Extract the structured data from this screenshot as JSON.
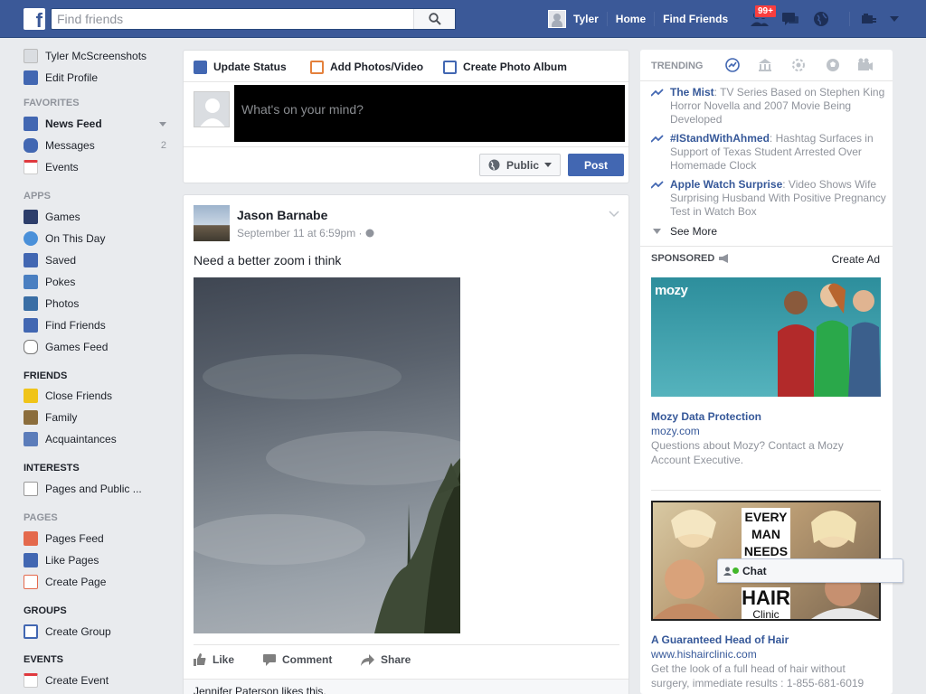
{
  "header": {
    "logo": "f",
    "search_placeholder": "Find friends",
    "profile_name": "Tyler",
    "home": "Home",
    "find_friends": "Find Friends",
    "notification_count": "99+"
  },
  "left_nav": {
    "user": "Tyler McScreenshots",
    "edit_profile": "Edit Profile",
    "favorites_head": "FAVORITES",
    "favorites": [
      {
        "label": "News Feed"
      },
      {
        "label": "Messages",
        "count": "2"
      },
      {
        "label": "Events"
      }
    ],
    "apps_head": "APPS",
    "apps": [
      "Games",
      "On This Day",
      "Saved",
      "Pokes",
      "Photos",
      "Find Friends",
      "Games Feed"
    ],
    "friends_head": "FRIENDS",
    "friends": [
      "Close Friends",
      "Family",
      "Acquaintances"
    ],
    "interests_head": "INTERESTS",
    "interests": [
      "Pages and Public ..."
    ],
    "pages_head": "PAGES",
    "pages": [
      "Pages Feed",
      "Like Pages",
      "Create Page"
    ],
    "groups_head": "GROUPS",
    "groups": [
      "Create Group"
    ],
    "events_head": "EVENTS",
    "events": [
      "Create Event"
    ]
  },
  "composer": {
    "tab_status": "Update Status",
    "tab_photos": "Add Photos/Video",
    "tab_album": "Create Photo Album",
    "placeholder": "What's on your mind?",
    "privacy": "Public",
    "post": "Post"
  },
  "post": {
    "author": "Jason Barnabe",
    "time": "September 11 at 6:59pm",
    "text": "Need a better zoom i think",
    "like": "Like",
    "comment": "Comment",
    "share": "Share",
    "likes_line": "Jennifer Paterson likes this."
  },
  "trending": {
    "head": "TRENDING",
    "items": [
      {
        "topic": "The Mist",
        "desc": ": TV Series Based on Stephen King Horror Novella and 2007 Movie Being Developed"
      },
      {
        "topic": "#IStandWithAhmed",
        "desc": ": Hashtag Surfaces in Support of Texas Student Arrested Over Homemade Clock"
      },
      {
        "topic": "Apple Watch Surprise",
        "desc": ": Video Shows Wife Surprising Husband With Positive Pregnancy Test in Watch Box"
      }
    ],
    "see_more": "See More"
  },
  "sponsored": {
    "head": "SPONSORED",
    "create_ad": "Create Ad",
    "ad1": {
      "logo": "mozy",
      "title": "Mozy Data Protection",
      "url": "mozy.com",
      "desc": "Questions about Mozy? Contact a Mozy Account Executive."
    },
    "ad2": {
      "headline_1": "EVERY",
      "headline_2": "MAN",
      "headline_3": "NEEDS",
      "headline_4": "HAIR",
      "headline_5": "Clinic",
      "title": "A Guaranteed Head of Hair",
      "url": "www.hishairclinic.com",
      "desc": "Get the look of a full head of hair without surgery, immediate results : 1-855-681-6019"
    }
  },
  "chat": {
    "label": "Chat"
  },
  "colors": {
    "brand": "#3b5998",
    "link": "#365899",
    "post_button": "#4267b2",
    "badge": "#fa3e3e"
  }
}
